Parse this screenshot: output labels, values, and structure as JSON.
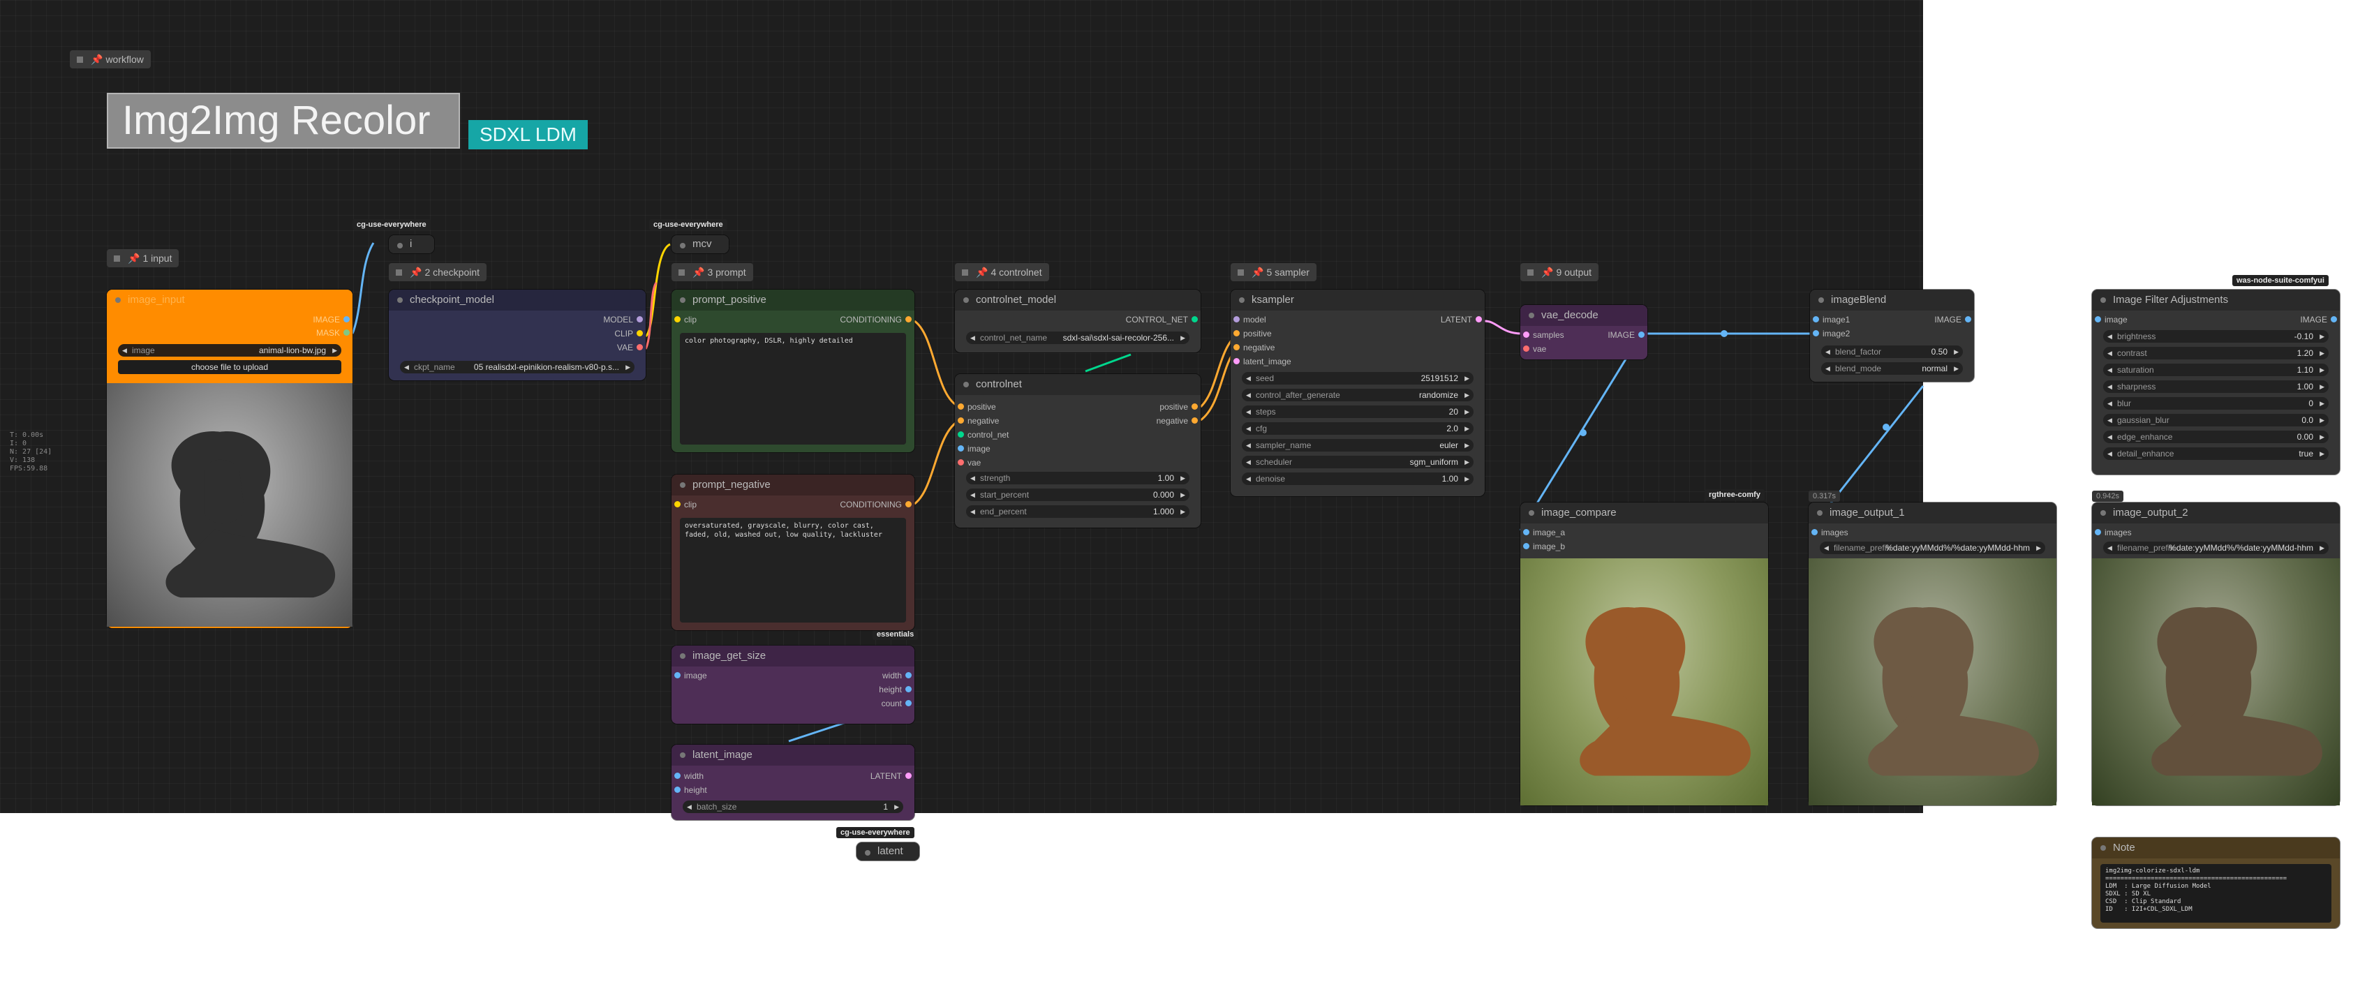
{
  "canvas": {
    "title": "Img2Img Recolor",
    "subtitle": "SDXL LDM",
    "stats": [
      "T: 0.00s",
      "I: 0",
      "N: 27 [24]",
      "V: 138",
      "FPS:59.88"
    ]
  },
  "colors": {
    "canvas_bg": "#1e1e1e",
    "node_bg": "#353535",
    "input_node": "#ff8c00",
    "checkpoint_node": "#323250",
    "prompt_positive_node": "#2e4a2e",
    "prompt_negative_node": "#4a2e2e",
    "latent_node": "#4e2e56",
    "accent_teal": "#16a6a6",
    "note_node": "#5a4828",
    "link_image": "#64b5f6",
    "link_clip": "#ffd500",
    "link_conditioning": "#ffa931",
    "link_latent": "#ff9cf9",
    "link_vae": "#ff6e6e",
    "link_control_net": "#00d78d",
    "link_model": "#b39ddb"
  },
  "groups": {
    "workflow": "workflow",
    "input": "1 input",
    "checkpoint": "2 checkpoint",
    "prompt": "3 prompt",
    "controlnet": "4 controlnet",
    "sampler": "5 sampler",
    "output": "9 output"
  },
  "tags": {
    "cg1": "cg-use-everywhere",
    "cg2": "cg-use-everywhere",
    "cg3": "cg-use-everywhere",
    "essentials": "essentials",
    "rgthree": "rgthree-comfy",
    "was": "was-node-suite-comfyui"
  },
  "small_nodes": {
    "i": "i",
    "mcv": "mcv",
    "latent": "latent"
  },
  "timings": {
    "out1": "0.317s",
    "out2": "0.942s"
  },
  "icons": {
    "group": "square-icon",
    "pin": "pin-icon",
    "node_collapse": "circle-dot-icon"
  },
  "nodes": {
    "image_input": {
      "title": "image_input",
      "out_image": "IMAGE",
      "out_mask": "MASK",
      "widget_label": "image",
      "widget_value": "animal-lion-bw.jpg",
      "button": "choose file to upload"
    },
    "checkpoint_model": {
      "title": "checkpoint_model",
      "out_model": "MODEL",
      "out_clip": "CLIP",
      "out_vae": "VAE",
      "widget_label": "ckpt_name",
      "widget_value": "05 realisdxl-epinikion-realism-v80-p.s..."
    },
    "prompt_positive": {
      "title": "prompt_positive",
      "in_clip": "clip",
      "out": "CONDITIONING",
      "text": "color photography, DSLR, highly detailed"
    },
    "prompt_negative": {
      "title": "prompt_negative",
      "in_clip": "clip",
      "out": "CONDITIONING",
      "text": "oversaturated, grayscale, blurry, color cast, faded, old, washed out, low quality, lackluster"
    },
    "image_get_size": {
      "title": "image_get_size",
      "in_image": "image",
      "out_width": "width",
      "out_height": "height",
      "out_count": "count"
    },
    "latent_image": {
      "title": "latent_image",
      "in_width": "width",
      "in_height": "height",
      "out": "LATENT",
      "widget_label": "batch_size",
      "widget_value": "1"
    },
    "controlnet_model": {
      "title": "controlnet_model",
      "out": "CONTROL_NET",
      "widget_label": "control_net_name",
      "widget_value": "sdxl-sai\\sdxl-sai-recolor-256..."
    },
    "controlnet": {
      "title": "controlnet",
      "inputs": [
        "positive",
        "negative",
        "control_net",
        "image",
        "vae"
      ],
      "outputs": [
        "positive",
        "negative"
      ],
      "widgets": [
        {
          "label": "strength",
          "value": "1.00"
        },
        {
          "label": "start_percent",
          "value": "0.000"
        },
        {
          "label": "end_percent",
          "value": "1.000"
        }
      ]
    },
    "ksampler": {
      "title": "ksampler",
      "inputs": [
        "model",
        "positive",
        "negative",
        "latent_image"
      ],
      "out": "LATENT",
      "widgets": [
        {
          "label": "seed",
          "value": "25191512"
        },
        {
          "label": "control_after_generate",
          "value": "randomize"
        },
        {
          "label": "steps",
          "value": "20"
        },
        {
          "label": "cfg",
          "value": "2.0"
        },
        {
          "label": "sampler_name",
          "value": "euler"
        },
        {
          "label": "scheduler",
          "value": "sgm_uniform"
        },
        {
          "label": "denoise",
          "value": "1.00"
        }
      ]
    },
    "vae_decode": {
      "title": "vae_decode",
      "in_samples": "samples",
      "in_vae": "vae",
      "out": "IMAGE"
    },
    "image_compare": {
      "title": "image_compare",
      "in_a": "image_a",
      "in_b": "image_b"
    },
    "imageBlend": {
      "title": "imageBlend",
      "in_1": "image1",
      "in_2": "image2",
      "out": "IMAGE",
      "widgets": [
        {
          "label": "blend_factor",
          "value": "0.50"
        },
        {
          "label": "blend_mode",
          "value": "normal"
        }
      ]
    },
    "image_output_1": {
      "title": "image_output_1",
      "in_images": "images",
      "widget_label": "filename_prefix",
      "widget_value": "%date:yyMMdd%/%date:yyMMdd-hhm"
    },
    "filter_adjust": {
      "title": "Image Filter Adjustments",
      "in_image": "image",
      "out": "IMAGE",
      "widgets": [
        {
          "label": "brightness",
          "value": "-0.10"
        },
        {
          "label": "contrast",
          "value": "1.20"
        },
        {
          "label": "saturation",
          "value": "1.10"
        },
        {
          "label": "sharpness",
          "value": "1.00"
        },
        {
          "label": "blur",
          "value": "0"
        },
        {
          "label": "gaussian_blur",
          "value": "0.0"
        },
        {
          "label": "edge_enhance",
          "value": "0.00"
        },
        {
          "label": "detail_enhance",
          "value": "true"
        }
      ]
    },
    "image_output_2": {
      "title": "image_output_2",
      "in_images": "images",
      "widget_label": "filename_prefix",
      "widget_value": "%date:yyMMdd%/%date:yyMMdd-hhm"
    },
    "note": {
      "title": "Note",
      "text": "img2img-colorize-sdxl-ldm\n================================================\nLDM  : Large Diffusion Model\nSDXL : SD XL\nCSD  : Clip Standard\nID   : I2I+CDL_SDXL_LDM"
    }
  }
}
